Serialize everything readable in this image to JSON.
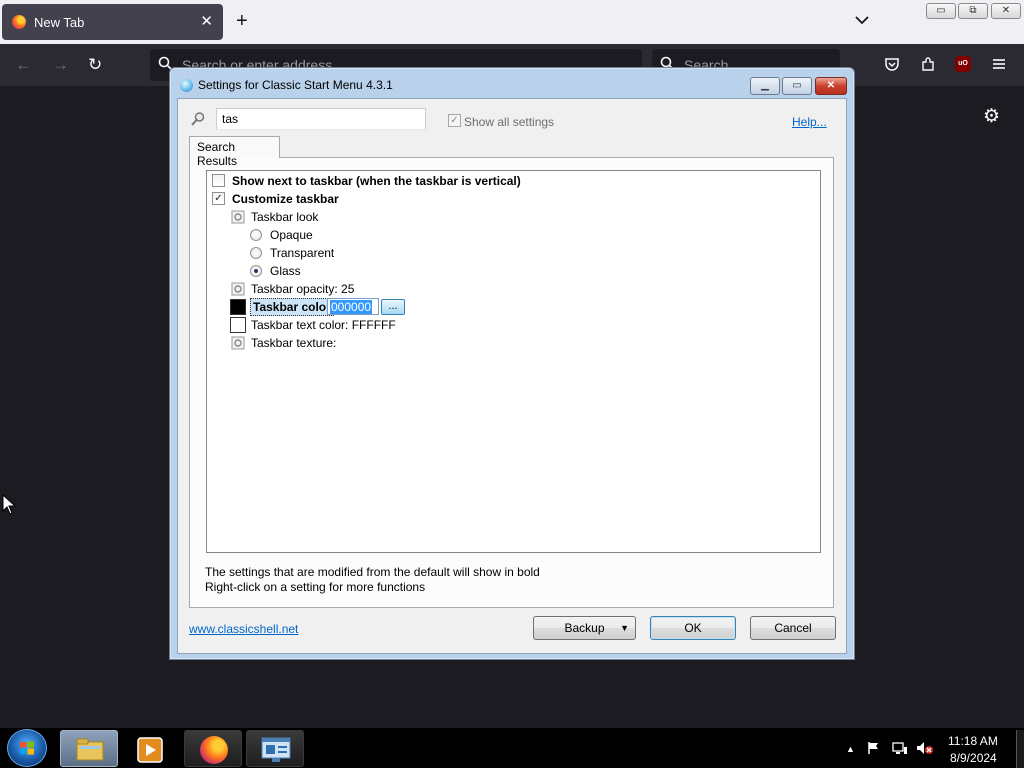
{
  "browser": {
    "tab_title": "New Tab",
    "tab_close": "✕",
    "new_tab": "+",
    "tab_list": "⌵",
    "address_placeholder": "Search or enter address",
    "search_placeholder": "Search",
    "back": "←",
    "forward": "→",
    "reload": "↻",
    "extension_badge": "uO",
    "window_minimize": "▭",
    "window_restore": "⧉",
    "window_close": "✕"
  },
  "dialog": {
    "title": "Settings for Classic Start Menu 4.3.1",
    "search_value": "tas",
    "show_all_label": "Show all settings",
    "show_all_checked": true,
    "help_link": "Help...",
    "tab_label": "Search Results",
    "tree": [
      {
        "label": "Show next to taskbar (when the taskbar is vertical)",
        "kind": "checkbox",
        "checked": false,
        "bold": true
      },
      {
        "label": "Customize taskbar",
        "kind": "checkbox",
        "checked": true,
        "bold": true
      },
      {
        "label": "Taskbar look",
        "kind": "group"
      },
      {
        "label": "Opaque",
        "kind": "radio",
        "checked": false
      },
      {
        "label": "Transparent",
        "kind": "radio",
        "checked": false
      },
      {
        "label": "Glass",
        "kind": "radio",
        "checked": true
      },
      {
        "label": "Taskbar opacity: 25",
        "kind": "setting"
      },
      {
        "label": "Taskbar color",
        "kind": "color",
        "color": "#000000",
        "bold": true,
        "edit_value": "000000",
        "edit_button": "..."
      },
      {
        "label": "Taskbar text color: FFFFFF",
        "kind": "color",
        "color": "#FFFFFF"
      },
      {
        "label": "Taskbar texture:",
        "kind": "setting"
      }
    ],
    "hint_line1": "The settings that are modified from the default will show in bold",
    "hint_line2": "Right-click on a setting for more functions",
    "site_link": "www.classicshell.net",
    "backup_button": "Backup",
    "ok_button": "OK",
    "cancel_button": "Cancel"
  },
  "taskbar": {
    "time": "11:18 AM",
    "date": "8/9/2024"
  },
  "colors": {
    "browser_dark": "#1c1b22",
    "dialog_frame": "#b9d1ea",
    "link": "#0066cc",
    "selection": "#3399ff"
  }
}
